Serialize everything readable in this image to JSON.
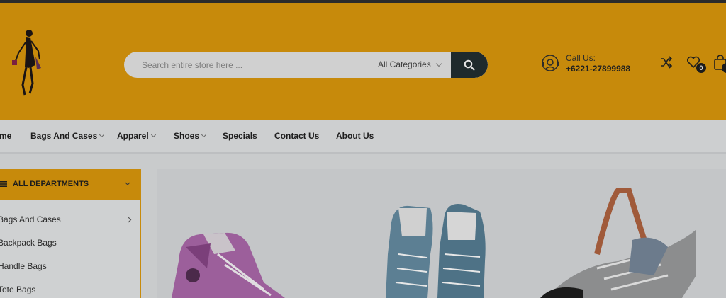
{
  "header": {
    "search": {
      "placeholder": "Search entire store here ...",
      "category": "All Categories"
    },
    "call": {
      "label": "Call Us:",
      "number": "+6221-27899988"
    },
    "wishlist_count": "0"
  },
  "nav": {
    "items": [
      {
        "label": "me"
      },
      {
        "label": "Bags And Cases"
      },
      {
        "label": "Apparel"
      },
      {
        "label": "Shoes"
      },
      {
        "label": "Specials"
      },
      {
        "label": "Contact Us"
      },
      {
        "label": "About Us"
      }
    ]
  },
  "departments": {
    "title": "ALL DEPARTMENTS",
    "items": [
      {
        "label": "Bags And Cases"
      },
      {
        "label": "Backpack Bags"
      },
      {
        "label": "Handle Bags"
      },
      {
        "label": "Tote Bags"
      }
    ]
  },
  "colors": {
    "accent": "#c78a0b",
    "dark": "#1f2a2c",
    "overlay_bg": "#c9cbcc"
  },
  "icons": [
    "logo-woman",
    "search-icon",
    "support-agent-icon",
    "shuffle-icon",
    "heart-icon",
    "cart-icon",
    "menu-icon",
    "chevron-down-icon",
    "chevron-right-icon"
  ]
}
